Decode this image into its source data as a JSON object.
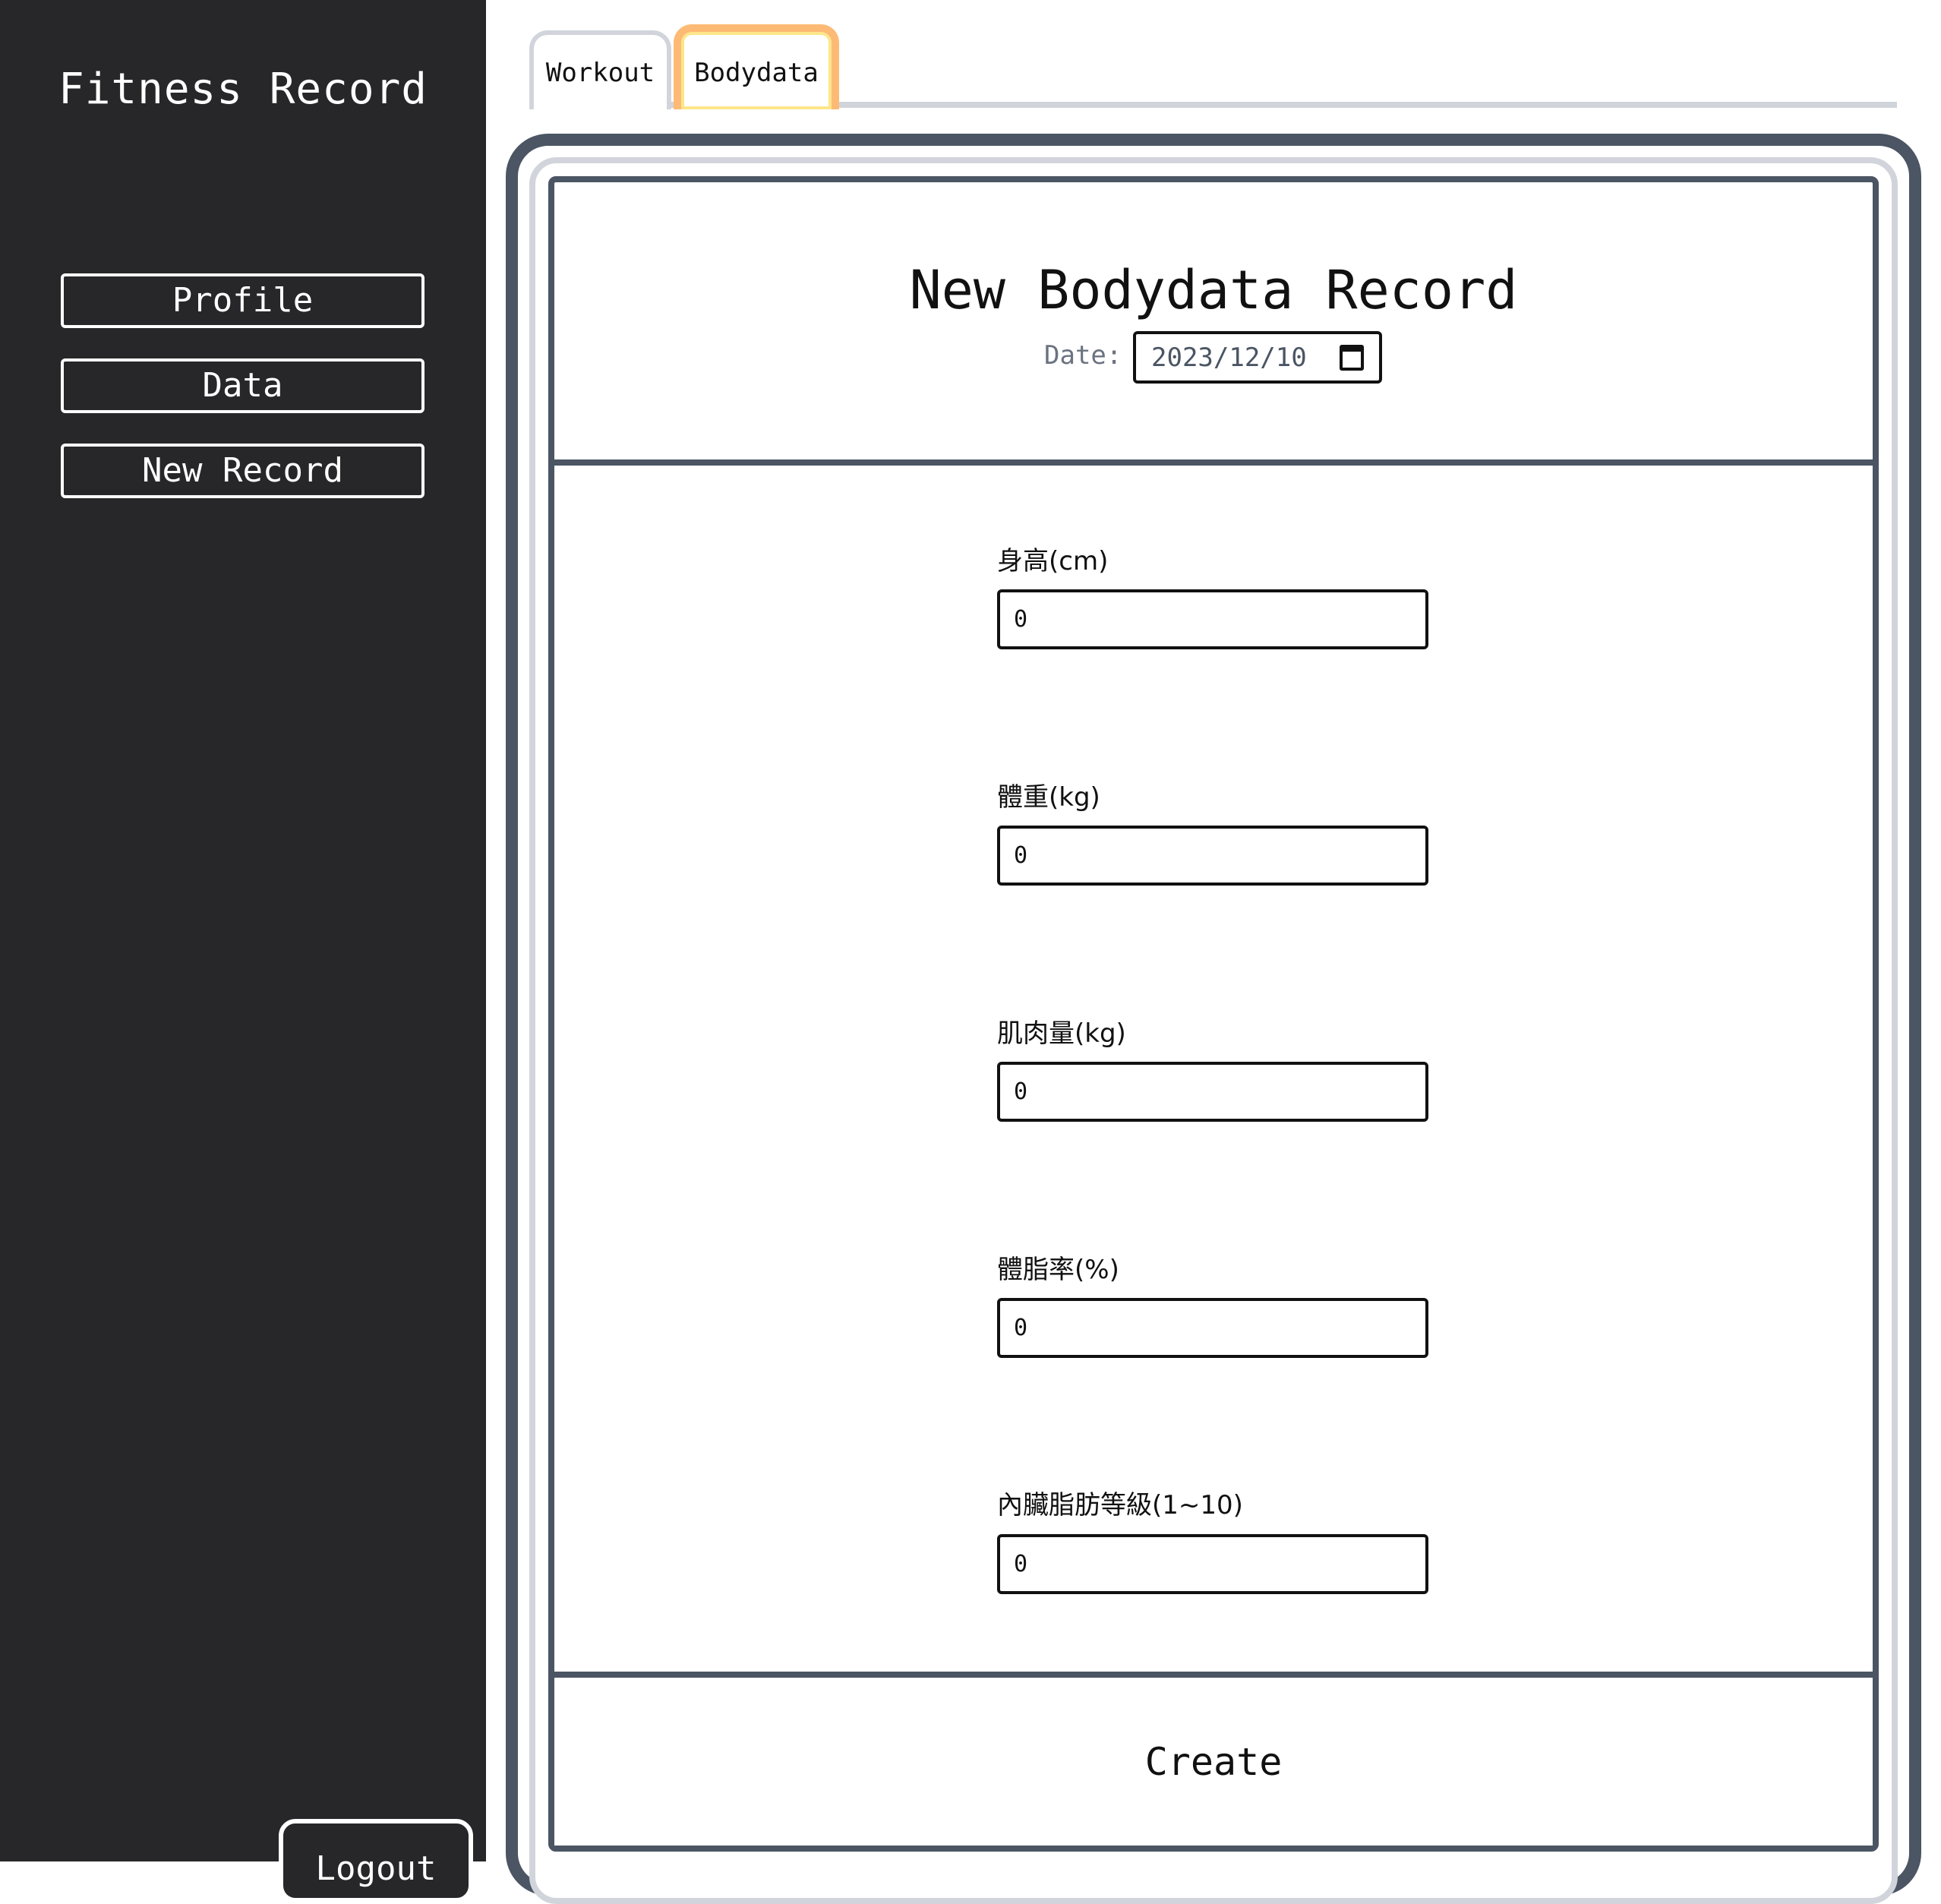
{
  "sidebar": {
    "title": "Fitness Record",
    "nav": {
      "profile": "Profile",
      "data": "Data",
      "new_record": "New Record"
    },
    "logout": "Logout"
  },
  "tabs": {
    "workout": "Workout",
    "bodydata": "Bodydata",
    "active": "Bodydata"
  },
  "form": {
    "title": "New Bodydata Record",
    "date_label": "Date:",
    "date_value": "2023/12/10",
    "fields": [
      {
        "label": "身高(cm)",
        "value": "0"
      },
      {
        "label": "體重(kg)",
        "value": "0"
      },
      {
        "label": "肌肉量(kg)",
        "value": "0"
      },
      {
        "label": "體脂率(%)",
        "value": "0"
      },
      {
        "label": "內臟脂肪等級(1~10)",
        "value": "0"
      }
    ],
    "submit": "Create"
  },
  "colors": {
    "sidebar_bg": "#27272a",
    "frame_dark": "#4b5563",
    "frame_light": "#d1d5db",
    "active_tab_border": "#fdba74"
  }
}
